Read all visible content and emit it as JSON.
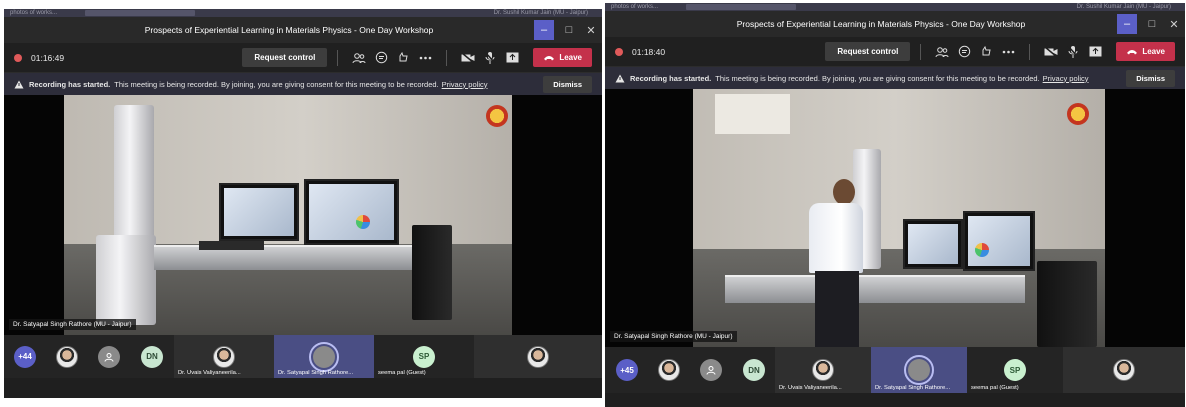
{
  "os_strip": {
    "tab": "photos of works...",
    "search": "Search",
    "user": "Dr. Sushil Kumar Jain (MU - Jaipur)"
  },
  "left": {
    "title": "Prospects of Experiential Learning in Materials Physics - One Day Workshop",
    "timer": "01:16:49",
    "request_control": "Request control",
    "leave": "Leave",
    "banner_bold": "Recording has started.",
    "banner_text": "This meeting is being recorded. By joining, you are giving consent for this meeting to be recorded.",
    "privacy": "Privacy policy",
    "dismiss": "Dismiss",
    "speaker_name": "Dr. Satyapal Singh Rathore (MU - Jaipur)",
    "participants_count": "+44",
    "initials_1": "DN",
    "initials_2": "SP",
    "tile_names": [
      "Dr. Uvais Valiyaneerila...",
      "Dr. Satyapal Singh Rathore...",
      "seema pal (Guest)"
    ]
  },
  "right": {
    "title": "Prospects of Experiential Learning in Materials Physics - One Day Workshop",
    "timer": "01:18:40",
    "request_control": "Request control",
    "leave": "Leave",
    "banner_bold": "Recording has started.",
    "banner_text": "This meeting is being recorded. By joining, you are giving consent for this meeting to be recorded.",
    "privacy": "Privacy policy",
    "dismiss": "Dismiss",
    "speaker_name": "Dr. Satyapal Singh Rathore (MU - Jaipur)",
    "participants_count": "+45",
    "initials_1": "DN",
    "initials_2": "SP",
    "tile_names": [
      "Dr. Uvais Valiyaneerila...",
      "Dr. Satyapal Singh Rathore...",
      "seema pal (Guest)"
    ]
  },
  "colors": {
    "accent": "#5b5fc7",
    "leave": "#c4314b",
    "recording": "#e05a5a",
    "banner": "#2d2d3a"
  }
}
